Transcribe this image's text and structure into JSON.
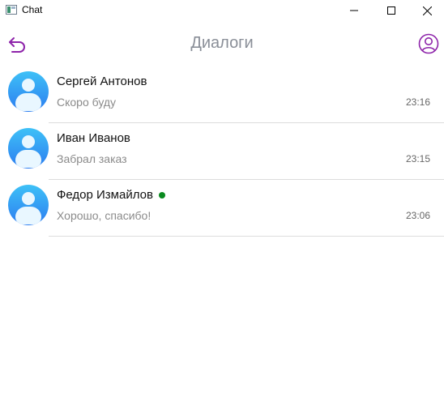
{
  "window": {
    "title": "Chat",
    "minimize_icon": "minimize-icon",
    "maximize_icon": "maximize-icon",
    "close_icon": "close-icon"
  },
  "header": {
    "title": "Диалоги",
    "back_icon": "back-arrow-icon",
    "profile_icon": "user-profile-icon",
    "accent_color": "#8e24aa"
  },
  "dialogs": [
    {
      "name": "Сергей Антонов",
      "last_message": "Скоро буду",
      "time": "23:16",
      "online": false
    },
    {
      "name": "Иван Иванов",
      "last_message": "Забрал заказ",
      "time": "23:15",
      "online": false
    },
    {
      "name": "Федор Измайлов",
      "last_message": "Хорошо, спасибо!",
      "time": "23:06",
      "online": true
    }
  ],
  "colors": {
    "avatar_gradient_top": "#3ec1f7",
    "avatar_gradient_bottom": "#2c7cf0",
    "online": "#0a8a1f"
  }
}
